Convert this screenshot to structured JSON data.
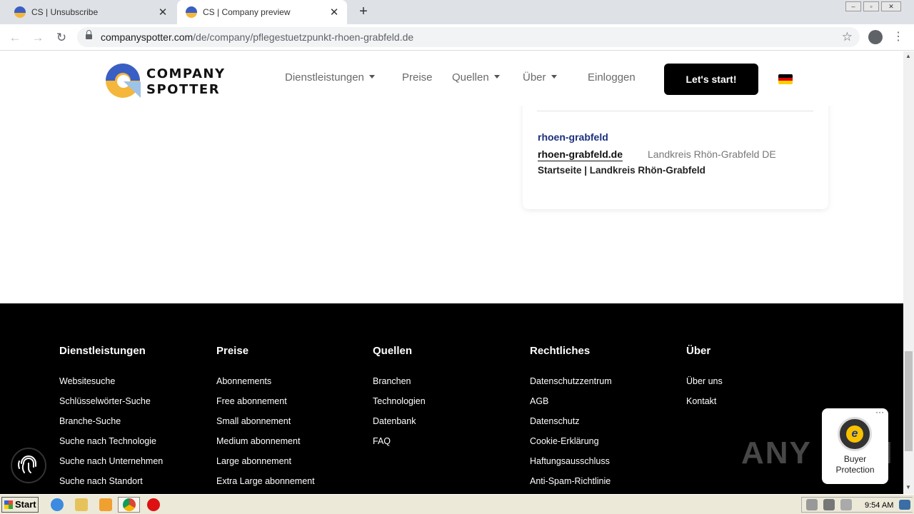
{
  "browser": {
    "tabs": [
      {
        "title": "CS | Unsubscribe",
        "active": false
      },
      {
        "title": "CS | Company preview",
        "active": true
      }
    ],
    "new_tab_symbol": "+",
    "url_domain": "companyspotter.com",
    "url_path": "/de/company/pflegestuetzpunkt-rhoen-grabfeld.de"
  },
  "header": {
    "logo_line1": "COMPANY",
    "logo_line2": "SPOTTER",
    "nav": {
      "services": "Dienstleistungen",
      "prices": "Preise",
      "sources": "Quellen",
      "about": "Über",
      "login": "Einloggen"
    },
    "cta": "Let's start!",
    "language_flag": "de"
  },
  "card": {
    "name": "rhoen-grabfeld",
    "domain": "rhoen-grabfeld.de",
    "location": "Landkreis Rhön-Grabfeld DE",
    "description": "Startseite | Landkreis Rhön-Grabfeld"
  },
  "footer": {
    "columns": [
      {
        "heading": "Dienstleistungen",
        "links": [
          "Websitesuche",
          "Schlüsselwörter-Suche",
          "Branche-Suche",
          "Suche nach Technologie",
          "Suche nach Unternehmen",
          "Suche nach Standort"
        ]
      },
      {
        "heading": "Preise",
        "links": [
          "Abonnements",
          "Free abonnement",
          "Small abonnement",
          "Medium abonnement",
          "Large abonnement",
          "Extra Large abonnement"
        ]
      },
      {
        "heading": "Quellen",
        "links": [
          "Branchen",
          "Technologien",
          "Datenbank",
          "FAQ"
        ]
      },
      {
        "heading": "Rechtliches",
        "links": [
          "Datenschutzzentrum",
          "AGB",
          "Datenschutz",
          "Cookie-Erklärung",
          "Haftungsausschluss",
          "Anti-Spam-Richtlinie"
        ]
      },
      {
        "heading": "Über",
        "links": [
          "Über uns",
          "Kontakt"
        ]
      }
    ]
  },
  "badge": {
    "line1": "Buyer",
    "line2": "Protection",
    "seal_letter": "e"
  },
  "watermark": "ANY RUN",
  "taskbar": {
    "start_label": "Start",
    "clock": "9:54 AM"
  },
  "colors": {
    "brand_blue": "#1b2f7d",
    "logo_yellow": "#f4b73c",
    "logo_blue": "#3a5fc4",
    "footer_bg": "#000000"
  }
}
